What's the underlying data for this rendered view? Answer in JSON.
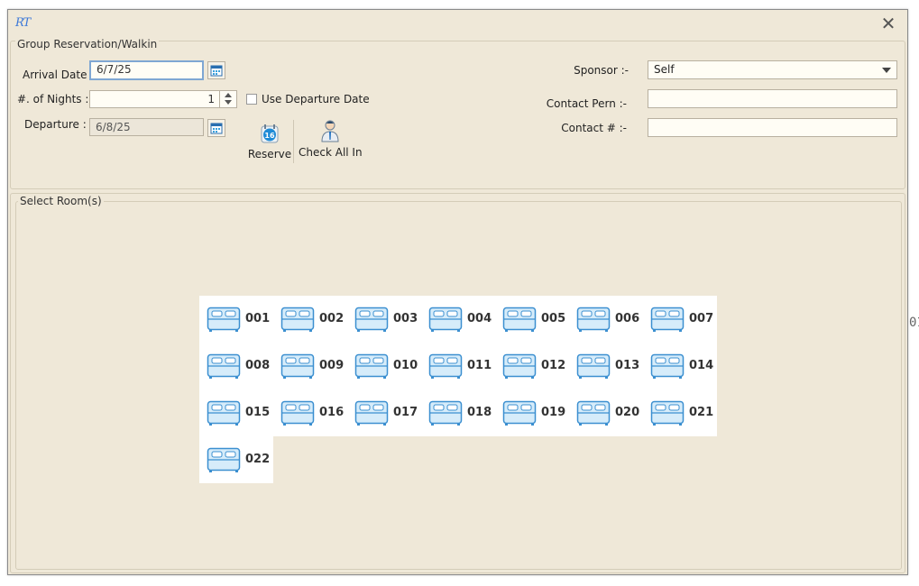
{
  "window": {
    "logo": "RT",
    "close_glyph": "✕"
  },
  "group": {
    "legend": "Group Reservation/Walkin",
    "arrival_label": "Arrival Date :",
    "arrival_value": "6/7/25",
    "nights_label": "#. of Nights :",
    "nights_value": "1",
    "use_departure_label": "Use Departure Date",
    "use_departure_checked": false,
    "departure_label": "Departure :",
    "departure_value": "6/8/25",
    "reserve_label": "Reserve",
    "reserve_icon_text": "16",
    "checkin_label": "Check All In",
    "sponsor_label": "Sponsor :-",
    "sponsor_value": "Self",
    "contact_person_label": "Contact Pern :-",
    "contact_person_value": "",
    "contact_number_label": "Contact # :-",
    "contact_number_value": ""
  },
  "rooms": {
    "legend": "Select Room(s)",
    "items": [
      "001",
      "002",
      "003",
      "004",
      "005",
      "006",
      "007",
      "008",
      "009",
      "010",
      "011",
      "012",
      "013",
      "014",
      "015",
      "016",
      "017",
      "018",
      "019",
      "020",
      "021",
      "022"
    ]
  },
  "colors": {
    "window_bg": "#efe8d8",
    "bed_fill": "#d6ecfa",
    "bed_stroke": "#3b8fd0",
    "focus_border": "#7fa7d3"
  },
  "edge_text": "01"
}
